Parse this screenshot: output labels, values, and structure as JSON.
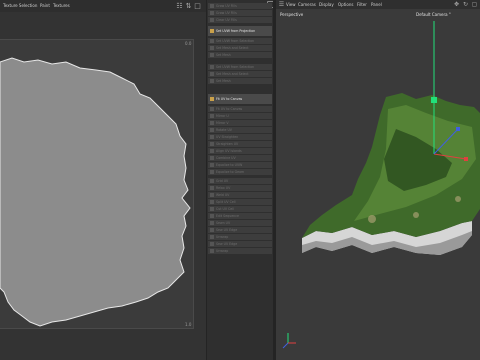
{
  "left_menu": [
    "Texture Selection",
    "Paint",
    "Textures"
  ],
  "uv_axes": {
    "top": "0.0",
    "bottom": "1.0"
  },
  "commands": [
    {
      "label": "Grow UV Fills",
      "state": "disabled"
    },
    {
      "label": "Grow UV Fills",
      "state": "disabled"
    },
    {
      "label": "Clear UV Fills",
      "state": "disabled"
    },
    {
      "label": "Set UVW from Projection",
      "state": "active"
    },
    {
      "label": "Set UVW from Selection",
      "state": "disabled"
    },
    {
      "label": "Set Mesh and Select",
      "state": "disabled"
    },
    {
      "label": "Set Mesh",
      "state": "disabled"
    },
    {
      "label": "Fit UV to Canvas",
      "state": "active"
    },
    {
      "label": "Fit UV to Canvas",
      "state": "disabled"
    },
    {
      "label": "Mirror U",
      "state": "disabled"
    },
    {
      "label": "Mirror V",
      "state": "disabled"
    },
    {
      "label": "Rotate UV",
      "state": "disabled"
    },
    {
      "label": "UV Straighten",
      "state": "disabled"
    },
    {
      "label": "Straighten UV",
      "state": "disabled"
    },
    {
      "label": "Align UV Islands",
      "state": "disabled"
    },
    {
      "label": "Combine UV",
      "state": "disabled"
    },
    {
      "label": "Equalize to UVW",
      "state": "disabled"
    },
    {
      "label": "Equalize to Geom",
      "state": "disabled"
    },
    {
      "label": "Grid UV",
      "state": "disabled"
    },
    {
      "label": "Relax UV",
      "state": "disabled"
    },
    {
      "label": "Weld UV",
      "state": "disabled"
    },
    {
      "label": "Split UV Cell",
      "state": "disabled"
    },
    {
      "label": "Cut UV Cell",
      "state": "disabled"
    },
    {
      "label": "Edit Sequence",
      "state": "disabled"
    },
    {
      "label": "Sewn UV",
      "state": "disabled"
    },
    {
      "label": "Sew UV Edge",
      "state": "disabled"
    },
    {
      "label": "Unwrap",
      "state": "disabled"
    }
  ],
  "viewport": {
    "menu": [
      "View",
      "Cameras",
      "Display",
      "Options",
      "Filter",
      "Panel"
    ],
    "label_perspective": "Perspective",
    "label_camera": "Default Camera °",
    "colors": {
      "terrain": "#3f6a2a",
      "cliff": "#cfcfcf",
      "axis_y": "#22e07a",
      "axis_x": "#e04040",
      "axis_z": "#4060e0"
    }
  }
}
